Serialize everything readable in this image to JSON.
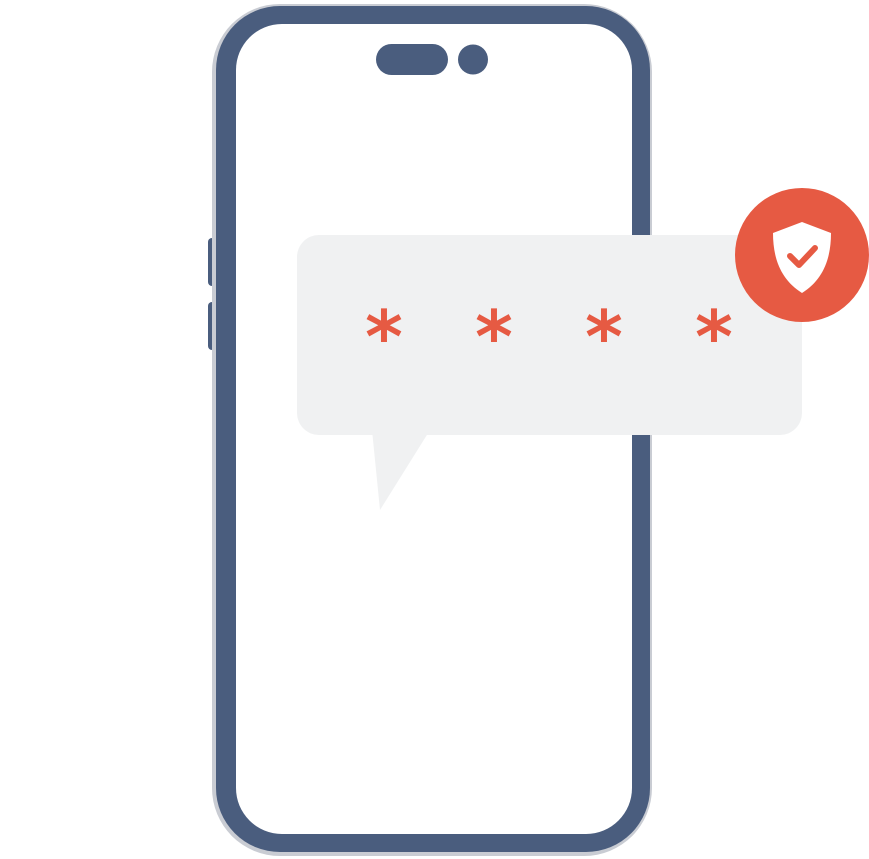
{
  "illustration": {
    "code_bubble": {
      "masked_chars": [
        "*",
        "*",
        "*",
        "*"
      ]
    },
    "badge": {
      "icon": "shield-check-icon"
    },
    "colors": {
      "phone_frame": "#4a5d7e",
      "phone_edge": "#c9ccd3",
      "bubble_bg": "#f0f1f2",
      "accent": "#e65a43"
    }
  }
}
